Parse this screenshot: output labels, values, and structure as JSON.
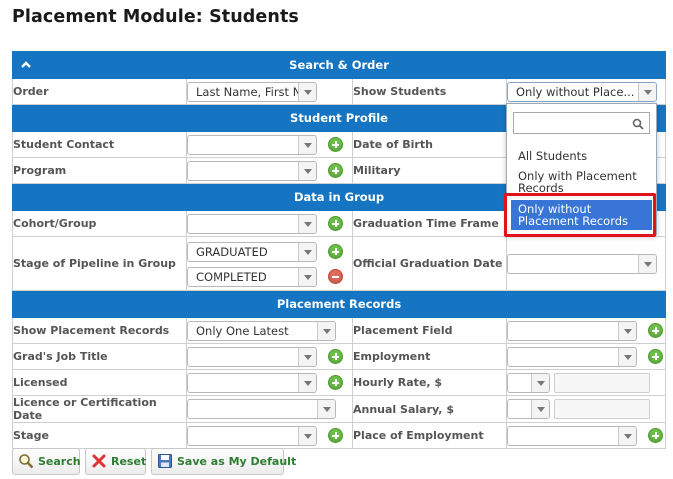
{
  "page_title": "Placement Module: Students",
  "sections": {
    "search_order": "Search & Order",
    "student_profile": "Student Profile",
    "data_in_group": "Data in Group",
    "placement_records": "Placement Records"
  },
  "fields": {
    "order": {
      "label": "Order",
      "value": "Last Name, First N..."
    },
    "show_students": {
      "label": "Show Students",
      "value": "Only without Place..."
    },
    "student_contact": {
      "label": "Student Contact",
      "value": ""
    },
    "date_of_birth": {
      "label": "Date of Birth"
    },
    "program": {
      "label": "Program",
      "value": ""
    },
    "military": {
      "label": "Military"
    },
    "cohort_group": {
      "label": "Cohort/Group",
      "value": ""
    },
    "graduation_time_frame": {
      "label": "Graduation Time Frame"
    },
    "stage_of_pipeline": {
      "label": "Stage of Pipeline in Group",
      "values": [
        "GRADUATED",
        "COMPLETED"
      ]
    },
    "official_graduation_date": {
      "label": "Official Graduation Date",
      "value": ""
    },
    "show_placement_records": {
      "label": "Show Placement Records",
      "value": "Only One Latest"
    },
    "placement_field": {
      "label": "Placement Field",
      "value": ""
    },
    "grads_job_title": {
      "label": "Grad's Job Title",
      "value": ""
    },
    "employment": {
      "label": "Employment",
      "value": ""
    },
    "licensed": {
      "label": "Licensed",
      "value": ""
    },
    "hourly_rate": {
      "label": "Hourly Rate, $",
      "value": ""
    },
    "licence_date": {
      "label": "Licence or Certification Date",
      "value": ""
    },
    "annual_salary": {
      "label": "Annual Salary, $",
      "value": ""
    },
    "stage": {
      "label": "Stage",
      "value": ""
    },
    "place_of_employment": {
      "label": "Place of Employment",
      "value": ""
    }
  },
  "dropdown": {
    "search_value": "",
    "options": [
      "All Students",
      "Only with Placement Records",
      "Only without Placement Records"
    ],
    "selected_index": 2
  },
  "buttons": {
    "search": "Search",
    "reset": "Reset",
    "save_default": "Save as My Default"
  },
  "colors": {
    "section_header": "#1675c2",
    "highlight_border": "#e0121b",
    "selected_option": "#3875d7",
    "add_icon": "#6dbf4b",
    "remove_icon": "#e26a5b"
  }
}
